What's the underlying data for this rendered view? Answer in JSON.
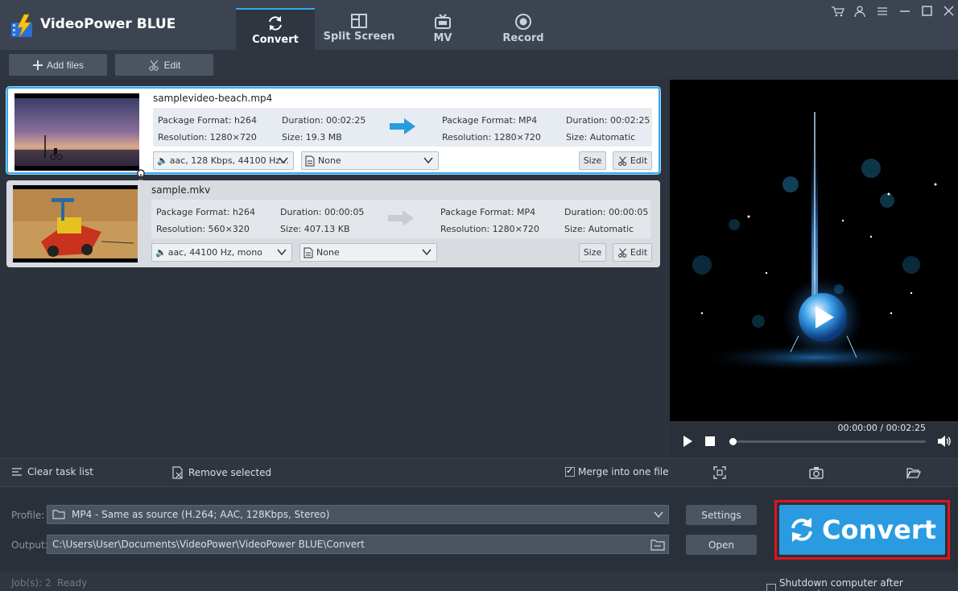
{
  "app": {
    "title": "VideoPower BLUE"
  },
  "tabs": [
    {
      "label": "Convert",
      "icon": "refresh-icon",
      "active": true
    },
    {
      "label": "Split Screen",
      "icon": "split-screen-icon"
    },
    {
      "label": "MV",
      "icon": "tv-icon"
    },
    {
      "label": "Record",
      "icon": "record-icon"
    }
  ],
  "window_controls": [
    "cart-icon",
    "user-icon",
    "menu-icon",
    "minimize-icon",
    "maximize-icon",
    "close-icon"
  ],
  "toolbar": {
    "add_files": "Add files",
    "edit": "Edit"
  },
  "tasks": [
    {
      "filename": "samplevideo-beach.mp4",
      "src_format": "Package Format: h264",
      "src_duration": "Duration: 00:02:25",
      "src_resolution": "Resolution: 1280×720",
      "src_size": "Size: 19.3 MB",
      "dst_format": "Package Format: MP4",
      "dst_duration": "Duration: 00:02:25",
      "dst_resolution": "Resolution: 1280×720",
      "dst_size": "Size: Automatic",
      "audio": "aac, 128 Kbps, 44100 Hz...",
      "subtitle": "None",
      "size_btn": "Size",
      "edit_btn": "Edit",
      "selected": true
    },
    {
      "filename": "sample.mkv",
      "src_format": "Package Format: h264",
      "src_duration": "Duration: 00:00:05",
      "src_resolution": "Resolution: 560×320",
      "src_size": "Size: 407.13 KB",
      "dst_format": "Package Format: MP4",
      "dst_duration": "Duration: 00:00:05",
      "dst_resolution": "Resolution: 1280×720",
      "dst_size": "Size: Automatic",
      "audio": "aac, 44100 Hz, mono",
      "subtitle": "None",
      "size_btn": "Size",
      "edit_btn": "Edit",
      "selected": false
    }
  ],
  "player": {
    "timecode": "00:00:00 / 00:02:25",
    "progress": 0.0
  },
  "taskbar": {
    "clear": "Clear task list",
    "remove": "Remove selected",
    "merge": "Merge into one file",
    "merge_checked": true
  },
  "profile": {
    "label": "Profile:",
    "value": "MP4 - Same as source (H.264; AAC, 128Kbps, Stereo)",
    "settings": "Settings"
  },
  "output": {
    "label": "Output:",
    "value": "C:\\Users\\User\\Documents\\VideoPower\\VideoPower BLUE\\Convert",
    "open": "Open"
  },
  "convert_button": "Convert",
  "status": {
    "jobs": "Job(s): 2",
    "state": "Ready",
    "shutdown": "Shutdown computer after conversion"
  },
  "colors": {
    "accent": "#35a8f0",
    "convert": "#2a9be0",
    "highlight": "#e0141e"
  }
}
